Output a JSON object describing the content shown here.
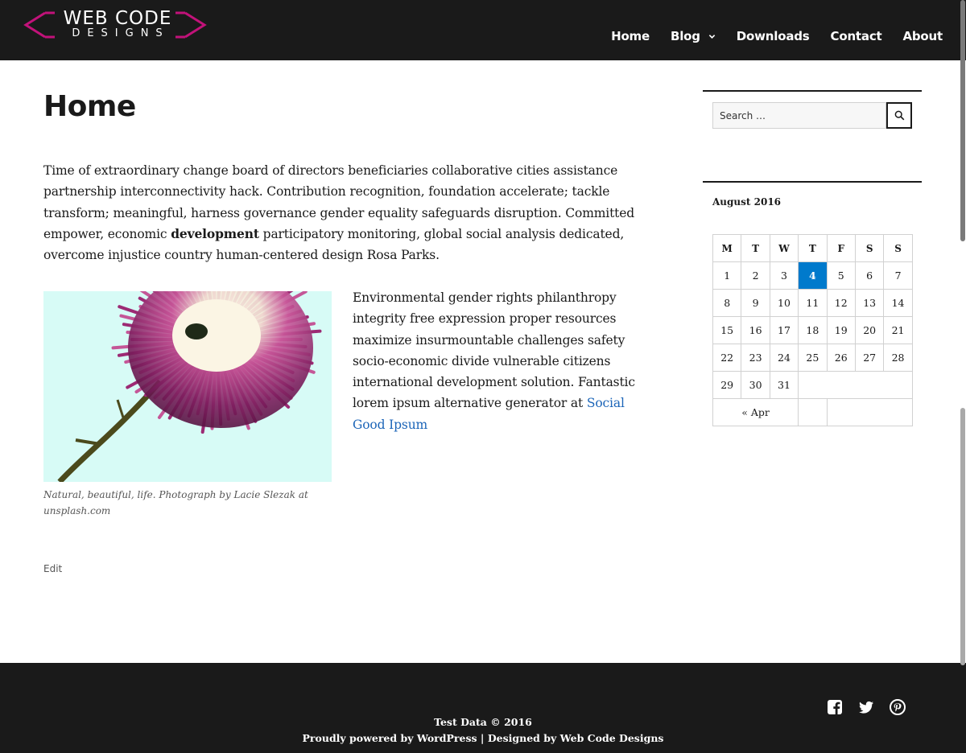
{
  "header": {
    "logo_line1": "WEB CODE",
    "logo_line2": "DESIGNS",
    "nav": [
      {
        "label": "Home"
      },
      {
        "label": "Blog"
      },
      {
        "label": "Downloads"
      },
      {
        "label": "Contact"
      },
      {
        "label": "About"
      }
    ],
    "colors": {
      "background": "#1a1a1a",
      "logo_accent": "#c2127a"
    }
  },
  "main": {
    "title": "Home",
    "intro_before": "Time of extraordinary change board of directors beneficiaries collaborative cities assistance partnership interconnectivity hack. Contribution recognition, foundation accelerate; tackle transform; meaningful, harness governance gender equality safeguards disruption. Committed empower, economic ",
    "intro_bold": "development",
    "intro_after": " participatory monitoring, global social analysis dedicated, overcome injustice country human-centered design Rosa Parks.",
    "caption": "Natural, beautiful, life. Photograph by Lacie Slezak at unsplash.com",
    "side_text": "Environmental gender rights philanthropy integrity free expression proper resources maximize insurmountable challenges safety socio-economic divide vulnerable citizens international development solution. Fantastic lorem ipsum alternative generator at ",
    "side_link": "Social Good Ipsum",
    "edit_label": "Edit",
    "link_color": "#1c65b8"
  },
  "sidebar": {
    "search": {
      "placeholder": "Search …",
      "icon": "search-icon"
    },
    "calendar": {
      "caption": "August 2016",
      "weekdays": [
        "M",
        "T",
        "W",
        "T",
        "F",
        "S",
        "S"
      ],
      "weeks": [
        [
          "1",
          "2",
          "3",
          "4",
          "5",
          "6",
          "7"
        ],
        [
          "8",
          "9",
          "10",
          "11",
          "12",
          "13",
          "14"
        ],
        [
          "15",
          "16",
          "17",
          "18",
          "19",
          "20",
          "21"
        ],
        [
          "22",
          "23",
          "24",
          "25",
          "26",
          "27",
          "28"
        ],
        [
          "29",
          "30",
          "31",
          "",
          "",
          "",
          ""
        ]
      ],
      "today": "4",
      "prev_label": "« Apr",
      "today_color": "#007acc"
    }
  },
  "footer": {
    "copyright": "Test Data © 2016",
    "powered": "Proudly powered by WordPress",
    "separator": "|",
    "designed": "Designed by Web Code Designs",
    "social": [
      "facebook-icon",
      "twitter-icon",
      "pinterest-icon"
    ]
  }
}
